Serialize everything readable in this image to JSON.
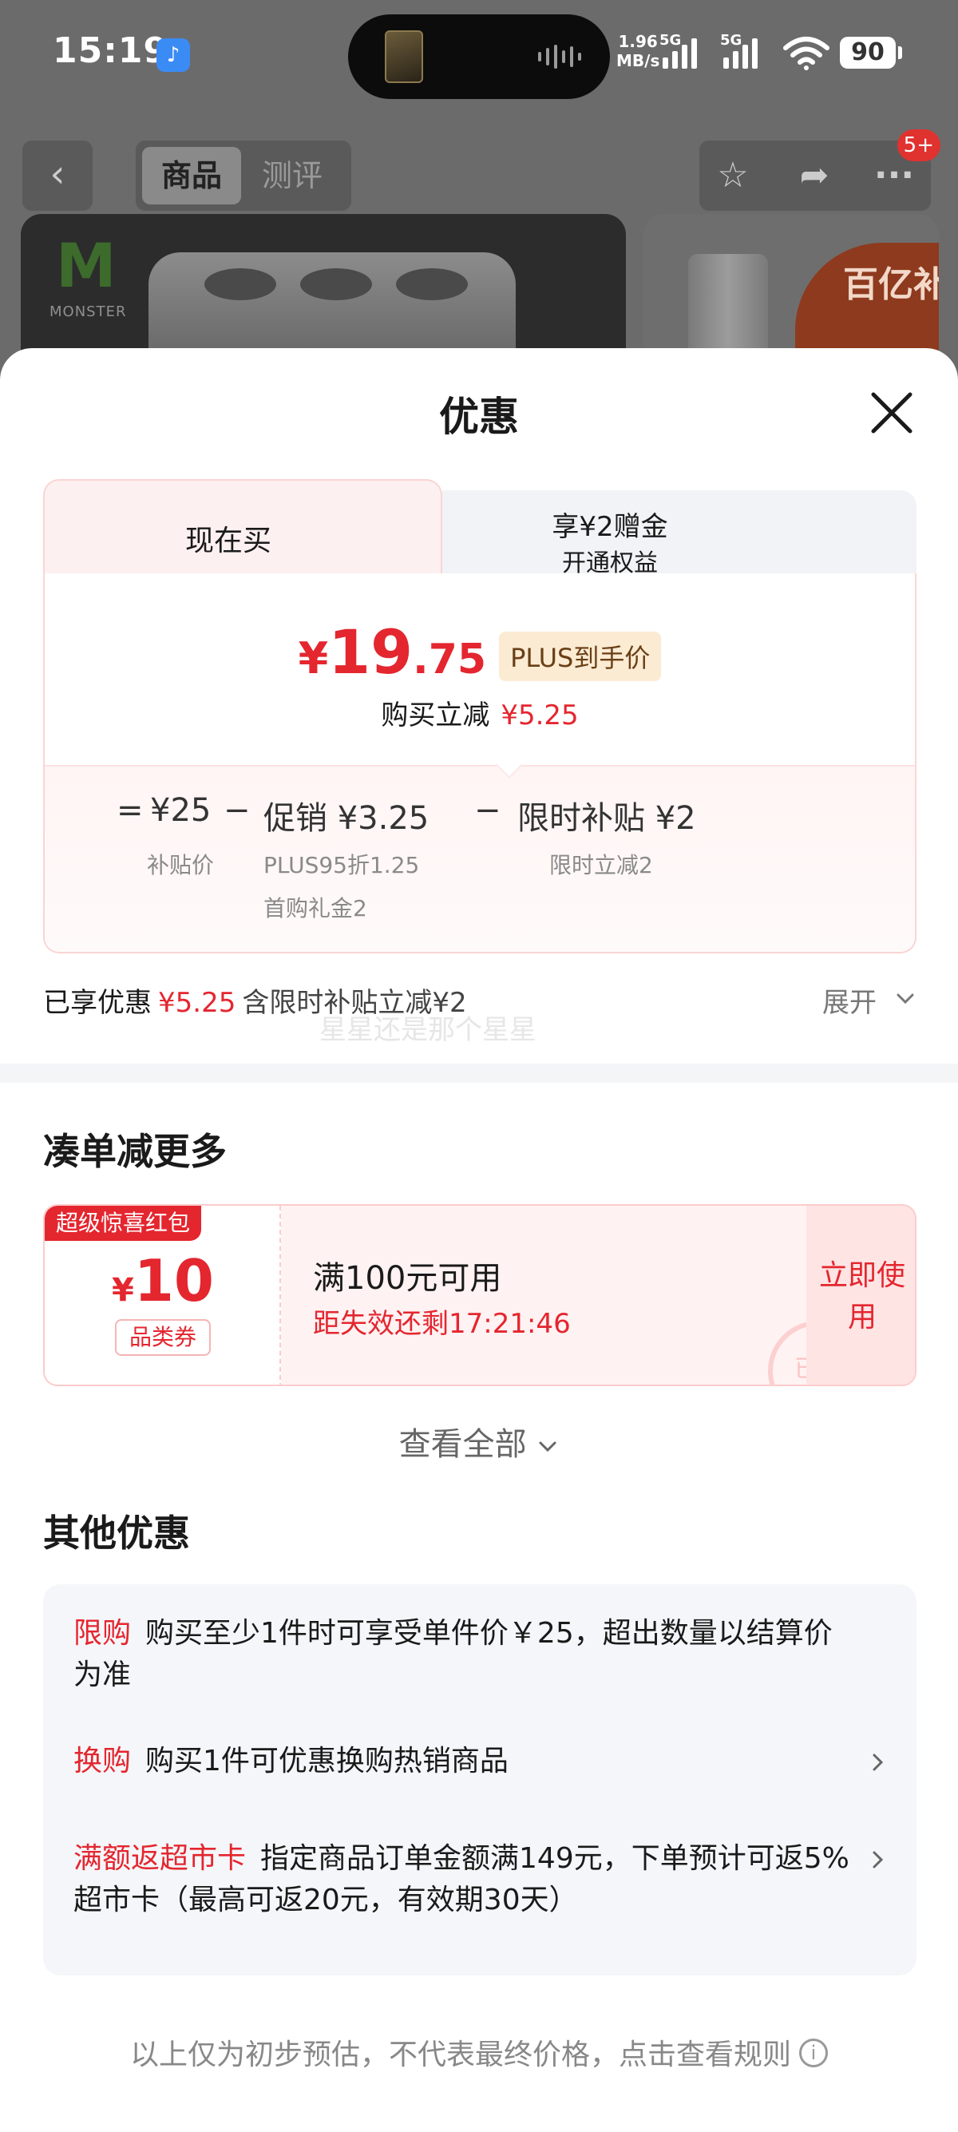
{
  "status_bar": {
    "time": "15:19",
    "net_speed_value": "1.96",
    "net_speed_unit": "MB/s",
    "signal1_label": "5G",
    "signal2_label": "5G",
    "battery": "90"
  },
  "background_page": {
    "tabs": [
      "商品",
      "测评"
    ],
    "notification_badge": "5+",
    "subsidy_banner": "百亿补贴",
    "brand_logo_text": "MONSTER"
  },
  "sheet": {
    "title": "优惠",
    "card": {
      "tab_now": "现在买",
      "tab_other_line1": "享¥2赠金",
      "tab_other_line2": "开通权益",
      "price_yen": "¥",
      "price_int": "19",
      "price_dec": ".75",
      "plus_tag": "PLUS到手价",
      "reduce_label": "购买立减",
      "reduce_value": "¥5.25",
      "calc": {
        "equals": "=",
        "subsidy_price": "¥25",
        "subsidy_price_label": "补贴价",
        "minus1": "−",
        "promo": "促销 ¥3.25",
        "promo_detail1": "PLUS95折1.25",
        "promo_detail2": "首购礼金2",
        "minus2": "−",
        "limited": "限时补贴 ¥2",
        "limited_detail": "限时立减2"
      }
    },
    "enjoyed": {
      "label": "已享优惠",
      "value": "¥5.25",
      "note": "含限时补贴立减¥2",
      "expand": "展开",
      "watermark": "星星还是那个星星"
    },
    "more_section": {
      "title": "凑单减更多",
      "coupon": {
        "tag": "超级惊喜红包",
        "yen": "¥",
        "amount": "10",
        "type": "品类券",
        "condition": "满100元可用",
        "expiry": "距失效还剩17:21:46",
        "stamp": "已领",
        "button": "立即使用"
      },
      "view_all": "查看全部"
    },
    "other_section": {
      "title": "其他优惠",
      "items": [
        {
          "label": "限购",
          "text": "购买至少1件时可享受单件价￥25，超出数量以结算价为准"
        },
        {
          "label": "换购",
          "text": "购买1件可优惠换购热销商品"
        },
        {
          "label": "满额返超市卡",
          "text": "指定商品订单金额满149元，下单预计可返5%超市卡（最高可返20元，有效期30天）"
        }
      ]
    },
    "footer": "以上仅为初步预估，不代表最终价格，点击查看规则"
  }
}
